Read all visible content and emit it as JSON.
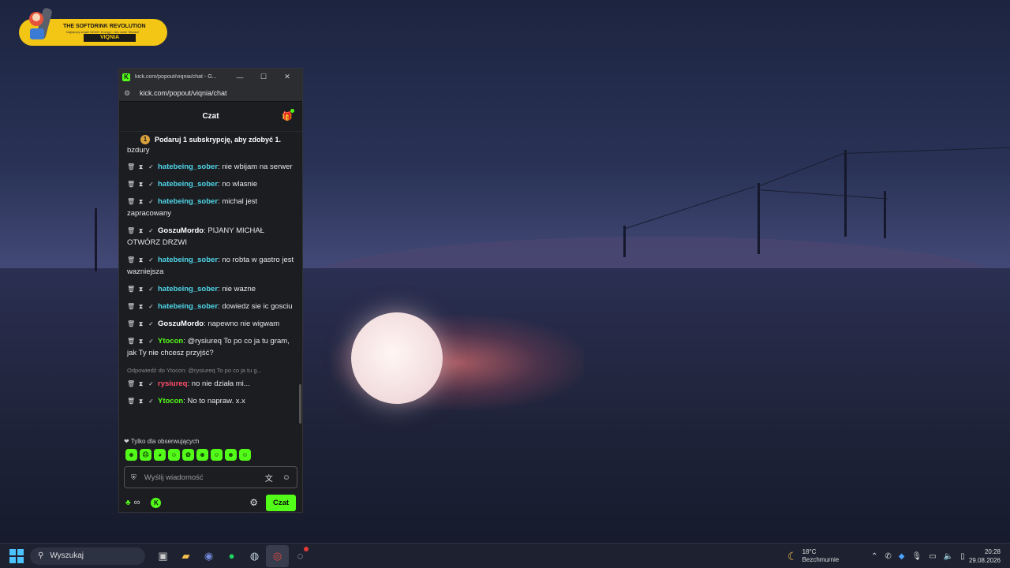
{
  "logo": {
    "title": "THE SOFTDRINK REVOLUTION",
    "subtitle": "Najlepszy smak! NOWY Energy! • dla mnie! Sharez!",
    "name": "VIQNIA"
  },
  "browser": {
    "tab_title": "kick.com/popout/viqnia/chat - G...",
    "url": "kick.com/popout/viqnia/chat",
    "controls": {
      "minimize": "—",
      "maximize": "☐",
      "close": "✕"
    }
  },
  "chat": {
    "header": "Czat",
    "sub_banner": {
      "count": "1",
      "text": "Podaruj 1 subskrypcję, aby zdobyć 1."
    },
    "cut_message": "bzdury",
    "messages": [
      {
        "user": "hatebeing_sober",
        "color": "#4fd6e8",
        "text": "nie wbijam na serwer"
      },
      {
        "user": "hatebeing_sober",
        "color": "#4fd6e8",
        "text": "no wlasnie"
      },
      {
        "user": "hatebeing_sober",
        "color": "#4fd6e8",
        "text": "michal jest zapracowany"
      },
      {
        "user": "GoszuMordo",
        "color": "#ffffff",
        "text": "PIJANY MICHAŁ OTWÓRZ DRZWI"
      },
      {
        "user": "hatebeing_sober",
        "color": "#4fd6e8",
        "text": "no robta w gastro jest wazniejsza"
      },
      {
        "user": "hatebeing_sober",
        "color": "#4fd6e8",
        "text": "nie wazne"
      },
      {
        "user": "hatebeing_sober",
        "color": "#4fd6e8",
        "text": "dowiedz sie ic gosciu"
      },
      {
        "user": "GoszuMordo",
        "color": "#ffffff",
        "text": "napewno nie wigwam"
      },
      {
        "user": "Ytocon",
        "color": "#53fc18",
        "text": "@rysiureq To po co ja tu gram, jak Ty nie chcesz przyjść?"
      },
      {
        "reply": "Odpowiedź do Ytocon: @rysiureq To po co ja tu g...",
        "user": "rysiureq",
        "color": "#ff4d6a",
        "text": "no nie działa mi..."
      },
      {
        "user": "Ytocon",
        "color": "#53fc18",
        "text": "No to napraw. x.x"
      }
    ],
    "followers_only": "Tylko dla obserwujących",
    "emote_count": 9,
    "input_placeholder": "Wyślij wiadomość",
    "points_value": "∞",
    "send_label": "Czat"
  },
  "taskbar": {
    "search_label": "Wyszukaj",
    "apps": [
      "task-view",
      "file-explorer",
      "discord",
      "spotify",
      "steam",
      "chrome",
      "obs"
    ],
    "weather_temp": "18°C",
    "weather_desc": "Bezchmurnie",
    "time": "20:28",
    "date": "29.08.2026"
  }
}
